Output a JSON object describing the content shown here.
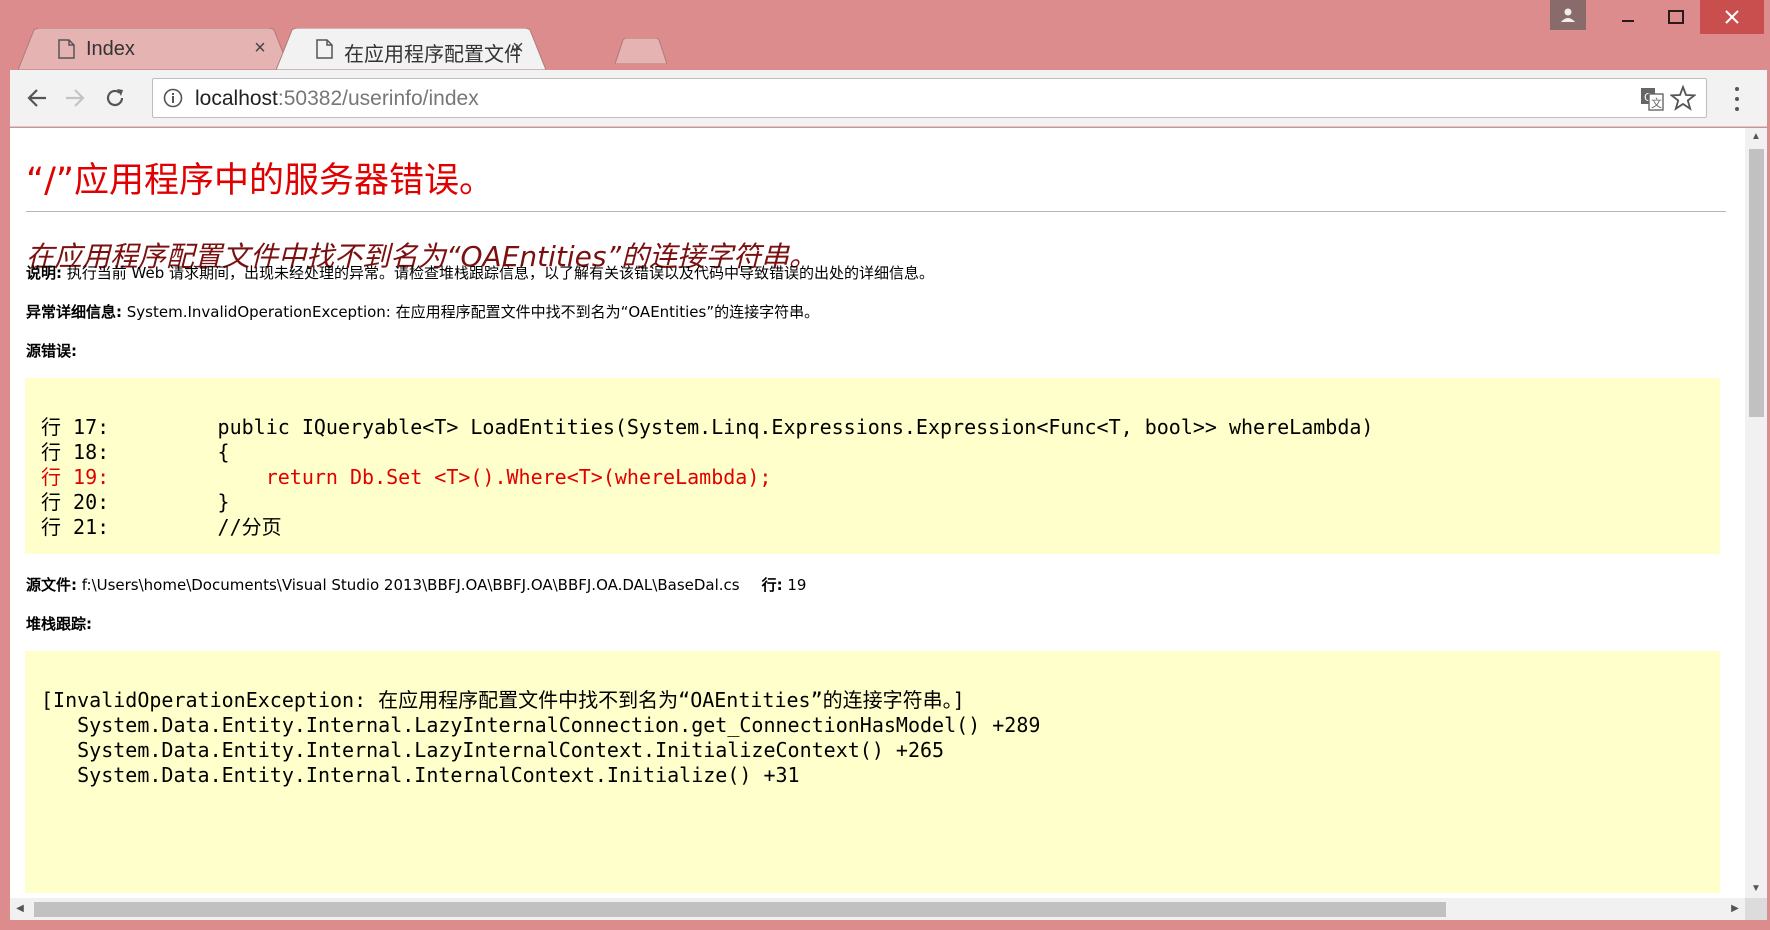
{
  "tabs": [
    {
      "title": "Index",
      "close": "×",
      "active": false
    },
    {
      "title": "在应用程序配置文件中找",
      "close": "×",
      "active": true
    }
  ],
  "window_controls": {
    "user": "user-icon",
    "minimize": "minimize-icon",
    "maximize": "maximize-icon",
    "close": "close-icon"
  },
  "omnibox": {
    "host": "localhost",
    "rest": ":50382/userinfo/index"
  },
  "page": {
    "heading": "“/”应用程序中的服务器错误。",
    "subheading": "在应用程序配置文件中找不到名为“OAEntities”的连接字符串。",
    "description_label": "说明:",
    "description_text": " 执行当前 Web 请求期间，出现未经处理的异常。请检查堆栈跟踪信息，以了解有关该错误以及代码中导致错误的出处的详细信息。",
    "exception_label": "异常详细信息:",
    "exception_text": " System.InvalidOperationException: 在应用程序配置文件中找不到名为“OAEntities”的连接字符串。",
    "source_error_label": "源错误:",
    "code_lines": [
      {
        "text": "行 17:         public IQueryable<T> LoadEntities(System.Linq.Expressions.Expression<Func<T, bool>> whereLambda)",
        "error": false
      },
      {
        "text": "行 18:         {",
        "error": false
      },
      {
        "text": "行 19:             return Db.Set <T>().Where<T>(whereLambda);",
        "error": true
      },
      {
        "text": "行 20:         }",
        "error": false
      },
      {
        "text": "行 21:         //分页",
        "error": false
      }
    ],
    "source_file_label": "源文件:",
    "source_file_path": " f:\\Users\\home\\Documents\\Visual Studio 2013\\BBFJ.OA\\BBFJ.OA\\BBFJ.OA.DAL\\BaseDal.cs",
    "line_label": "行:",
    "line_value": " 19",
    "stack_label": "堆栈跟踪:",
    "stack_lines": [
      "[InvalidOperationException: 在应用程序配置文件中找不到名为“OAEntities”的连接字符串。]",
      "   System.Data.Entity.Internal.LazyInternalConnection.get_ConnectionHasModel() +289",
      "   System.Data.Entity.Internal.LazyInternalContext.InitializeContext() +265",
      "   System.Data.Entity.Internal.InternalContext.Initialize() +31"
    ]
  },
  "colors": {
    "frame": "#dc8c8c",
    "error_red": "#e00000",
    "subheading": "#7a1010",
    "code_bg": "#ffffcc"
  }
}
